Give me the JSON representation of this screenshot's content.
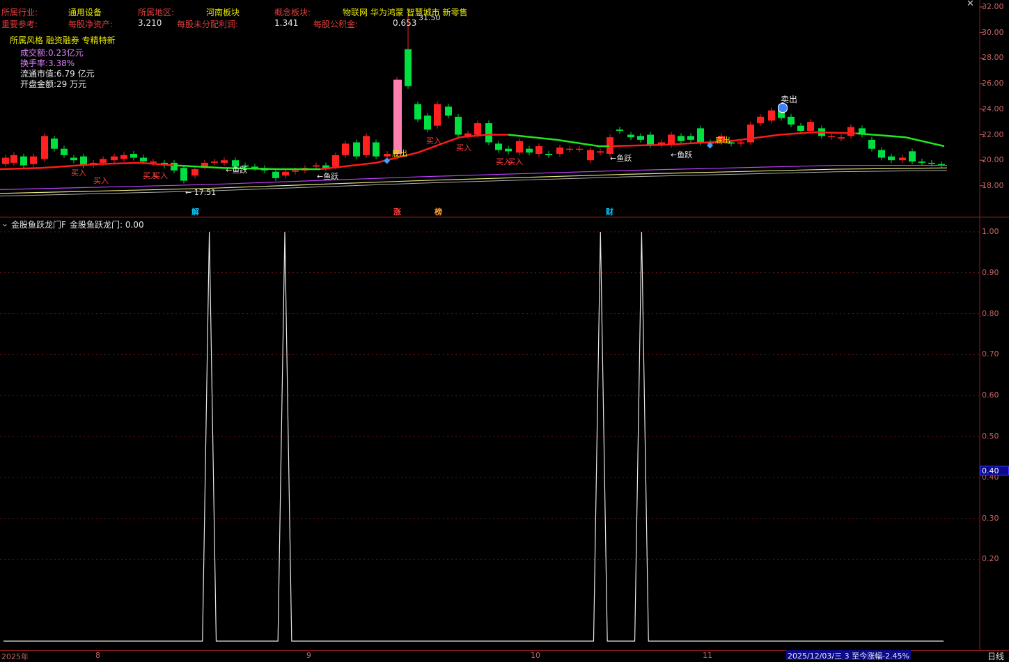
{
  "header": {
    "industry_label": "所属行业:",
    "industry_value": "通用设备",
    "region_label": "所属地区:",
    "region_value": "河南板块",
    "concept_label": "概念板块:",
    "concept_value": "物联网 华为鸿蒙 智慧城市 新零售",
    "ref_label": "重要参考:",
    "bvps_label": "每股净资产:",
    "bvps_value": "3.210",
    "undist_label": "每股未分配利润:",
    "undist_value": "1.341",
    "reserve_label": "每股公积金:",
    "reserve_value": "0.653",
    "style_tags": "所属风格 融资融券 专精特新"
  },
  "stats": {
    "turnover_amount": "成交额:0.23亿元",
    "turnover_rate": "换手率:3.38%",
    "float_cap": "流通市值:6.79 亿元",
    "open_amount": "开盘金额:29 万元"
  },
  "price_axis": [
    "32.00",
    "30.00",
    "28.00",
    "26.00",
    "24.00",
    "22.00",
    "20.00",
    "18.00"
  ],
  "annotations": {
    "high_price": "31.50",
    "low_price": "17.51",
    "sell": "卖出",
    "buy": "买入",
    "fish": "←鱼跃",
    "bottom_tag": "底出"
  },
  "events": [
    {
      "label": "解",
      "color": "#00c8ff"
    },
    {
      "label": "涨",
      "color": "#ff4040"
    },
    {
      "label": "榜",
      "color": "#ffa040"
    },
    {
      "label": "财",
      "color": "#00c8ff"
    }
  ],
  "indicator": {
    "name": "金股鱼跃龙门F",
    "value_text": "金股鱼跃龙门: 0.00",
    "axis": [
      "1.00",
      "0.90",
      "0.80",
      "0.70",
      "0.60",
      "0.50",
      "0.40",
      "0.30",
      "0.20"
    ],
    "current_marker": "0.40"
  },
  "dates": [
    "2025年",
    "8",
    "9",
    "10",
    "11"
  ],
  "status_text": "2025/12/03/三 3 至今涨幅-2.45%",
  "period_label": "日线",
  "colors": {
    "up": "#ff2020",
    "down": "#00e040",
    "ma_red": "#ff1a1a",
    "ma_green": "#1ee81e",
    "ma_purple": "#c040ff",
    "ma_yellow": "#e8e880",
    "grid": "#6b1515"
  },
  "chart_data": {
    "type": "candlestick",
    "ylim": [
      16.5,
      32.5
    ],
    "indicator_series": {
      "name": "金股鱼跃龙门",
      "values": [
        0,
        0,
        0,
        0,
        0,
        0,
        0,
        0,
        0,
        0,
        0,
        0,
        0,
        0,
        0,
        0,
        0,
        0,
        0,
        0,
        0,
        0,
        0,
        0,
        0,
        0,
        0,
        0,
        0,
        0,
        1,
        0,
        0,
        0,
        0,
        0,
        0,
        0,
        0,
        0,
        0,
        1,
        0,
        0,
        0,
        0,
        0,
        0,
        0,
        0,
        0,
        0,
        0,
        0,
        0,
        0,
        0,
        0,
        0,
        0,
        0,
        0,
        0,
        0,
        0,
        0,
        0,
        0,
        0,
        0,
        0,
        0,
        0,
        0,
        0,
        0,
        0,
        0,
        0,
        0,
        0,
        0,
        0,
        0,
        0,
        0,
        0,
        1,
        0,
        0,
        0,
        0,
        0,
        1,
        0,
        0,
        0,
        0,
        0,
        0,
        0,
        0,
        0,
        0,
        0,
        0,
        0,
        0,
        0,
        0,
        0,
        0,
        0,
        0,
        0,
        0,
        0,
        0,
        0,
        0,
        0,
        0,
        0,
        0,
        0,
        0,
        0,
        0,
        0,
        0,
        0,
        0,
        0,
        0,
        0,
        0,
        0,
        0
      ]
    }
  }
}
